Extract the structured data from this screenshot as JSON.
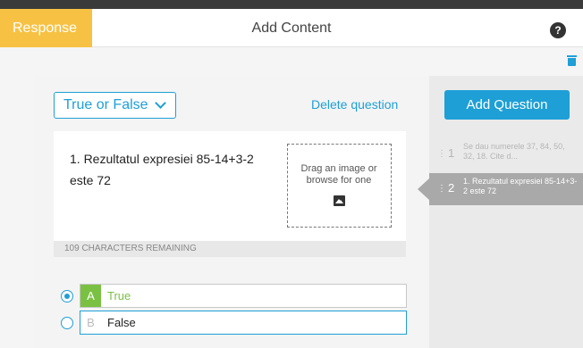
{
  "header": {
    "tab_label": "Response",
    "title": "Add Content",
    "help_icon": "?"
  },
  "toolbar": {
    "trash_icon": "trash-icon"
  },
  "editor": {
    "question_type": "True or False",
    "delete_label": "Delete question",
    "question_text": "1. Rezultatul expresiei 85-14+3-2 este 72",
    "dropzone_text": "Drag an image or browse for one",
    "image_icon": "image-icon",
    "chars_remaining": "109 CHARACTERS REMAINING",
    "options": [
      {
        "letter": "A",
        "label": "True",
        "selected": true
      },
      {
        "letter": "B",
        "label": "False",
        "selected": false
      }
    ]
  },
  "sidebar": {
    "add_button": "Add Question",
    "handle_glyph": "⋮",
    "questions": [
      {
        "number": "1",
        "snippet": "Se dau numerele 37, 84, 50, 32, 18. Cite d..."
      },
      {
        "number": "2",
        "snippet": "1. Rezultatul expresiei 85-14+3-2 este 72"
      }
    ]
  },
  "colors": {
    "accent": "#1e9fd6",
    "tab": "#f7c243",
    "correct": "#7ac143",
    "active_item": "#a9a9a9"
  }
}
